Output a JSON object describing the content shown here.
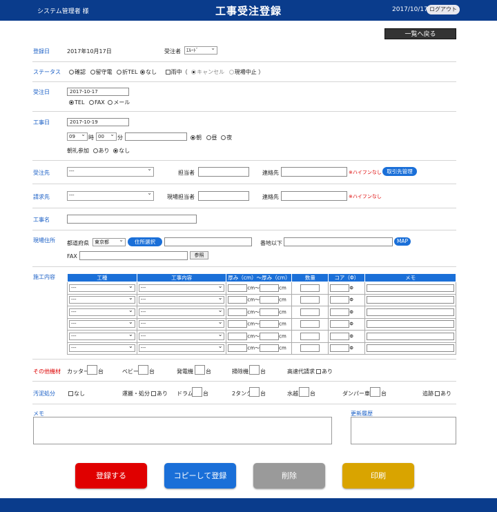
{
  "header": {
    "user": "システム管理者 様",
    "title": "工事受注登録",
    "date": "2017/10/17",
    "logout": "ログアウト"
  },
  "back_button": "一覧へ戻る",
  "registration": {
    "label": "登録日",
    "value": "2017年10月17日",
    "receiver_label": "受注者",
    "receiver_value": "ｴﾙｰﾄﾞ"
  },
  "status": {
    "label": "ステータス",
    "options": [
      "確認",
      "留守電",
      "折TEL",
      "なし"
    ],
    "rain_label": "雨中（",
    "rain_options": [
      "キャンセル",
      "現場中止"
    ],
    "rain_close": "）"
  },
  "order_date": {
    "label": "受注日",
    "value": "2017-10-17",
    "options": [
      "TEL",
      "FAX",
      "メール"
    ]
  },
  "work_date": {
    "label": "工事日",
    "value": "2017-10-19",
    "hour": "09",
    "hour_unit": "時",
    "minute": "00",
    "minute_unit": "分",
    "periods": [
      "朝",
      "昼",
      "夜"
    ],
    "morning_label": "朝礼参加",
    "morning_options": [
      "あり",
      "なし"
    ]
  },
  "client": {
    "label": "受注先",
    "select": "---",
    "person_label": "担当者",
    "contact_label": "連絡先",
    "note": "※ハイフンなし",
    "manage_button": "取引先管理"
  },
  "billing": {
    "label": "請求先",
    "select": "---",
    "person_label": "現場担当者",
    "contact_label": "連絡先",
    "note": "※ハイフンなし"
  },
  "work_name": {
    "label": "工事名"
  },
  "site": {
    "label": "現場住所",
    "pref_label": "都道府県",
    "pref_value": "東京都",
    "addr_button": "住所選択",
    "block_label": "番地以下",
    "map_button": "MAP",
    "fax_label": "FAX",
    "ref_button": "参照"
  },
  "construction": {
    "label": "施工内容",
    "headers": [
      "工種",
      "工事内容",
      "厚み（cm）～厚み（cm）",
      "数量",
      "コア（Φ）",
      "メモ"
    ],
    "rows": [
      {
        "type": "---",
        "content": "---"
      },
      {
        "type": "---",
        "content": "---"
      },
      {
        "type": "---",
        "content": "---"
      },
      {
        "type": "---",
        "content": "---"
      },
      {
        "type": "---",
        "content": "---"
      },
      {
        "type": "---",
        "content": "---"
      }
    ],
    "cm1": "cm～",
    "cm2": "cm",
    "phi": "Φ"
  },
  "other": {
    "label": "その他機材",
    "items": [
      "カッター",
      "ベビー",
      "発電機",
      "掃除機"
    ],
    "unit": "台",
    "highway": "高速代請求",
    "highway_opt": "あり"
  },
  "sludge": {
    "label": "汚泥処分",
    "none": "なし",
    "transport": "運搬・処分",
    "transport_opt": "あり",
    "drum": "ドラム",
    "tank": "2タンク",
    "water": "水越",
    "dumper": "ダンパー車",
    "unit": "台",
    "extra": "追跡",
    "extra_opt": "あり"
  },
  "memo": {
    "label": "メモ",
    "history_label": "更新履歴"
  },
  "actions": {
    "register": "登録する",
    "copy": "コピーして登録",
    "delete": "削除",
    "print": "印刷"
  },
  "colors": {
    "header": "#0a3c8c",
    "accent": "#1a6fd8",
    "register": "#e00000",
    "copy": "#1a6fd8",
    "delete": "#999999",
    "print": "#d9a400"
  }
}
